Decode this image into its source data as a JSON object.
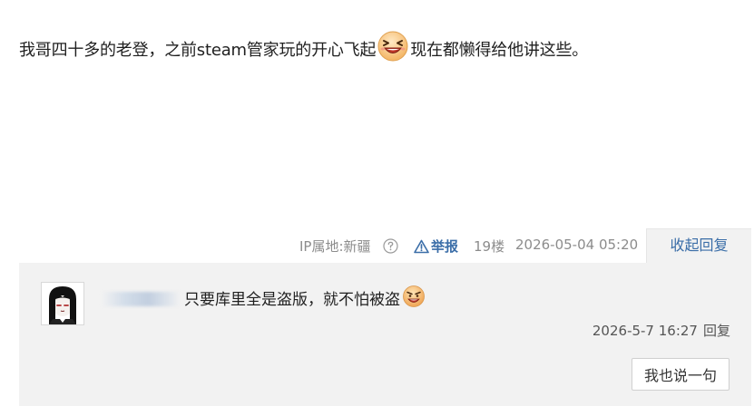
{
  "post": {
    "text_before_emoji": "我哥四十多的老登，之前steam管家玩的开心飞起",
    "text_after_emoji": "现在都懒得给他讲这些。",
    "emoji_icon": "laughing-face-emoji"
  },
  "post_meta": {
    "ip_location": "IP属地:新疆",
    "report_label": "举报",
    "floor": "19楼",
    "timestamp": "2026-05-04 05:20",
    "collapse_reply_label": "收起回复"
  },
  "reply": {
    "text": "只要库里全是盗版，就不怕被盗",
    "emoji_icon": "angry-face-emoji",
    "timestamp": "2026-5-7 16:27",
    "reply_label": "回复"
  },
  "reply_box": {
    "say_button_label": "我也说一句"
  },
  "colors": {
    "link_blue": "#3b6ea8",
    "panel_bg": "#f2f2f2",
    "meta_gray": "#8c8c8c"
  }
}
